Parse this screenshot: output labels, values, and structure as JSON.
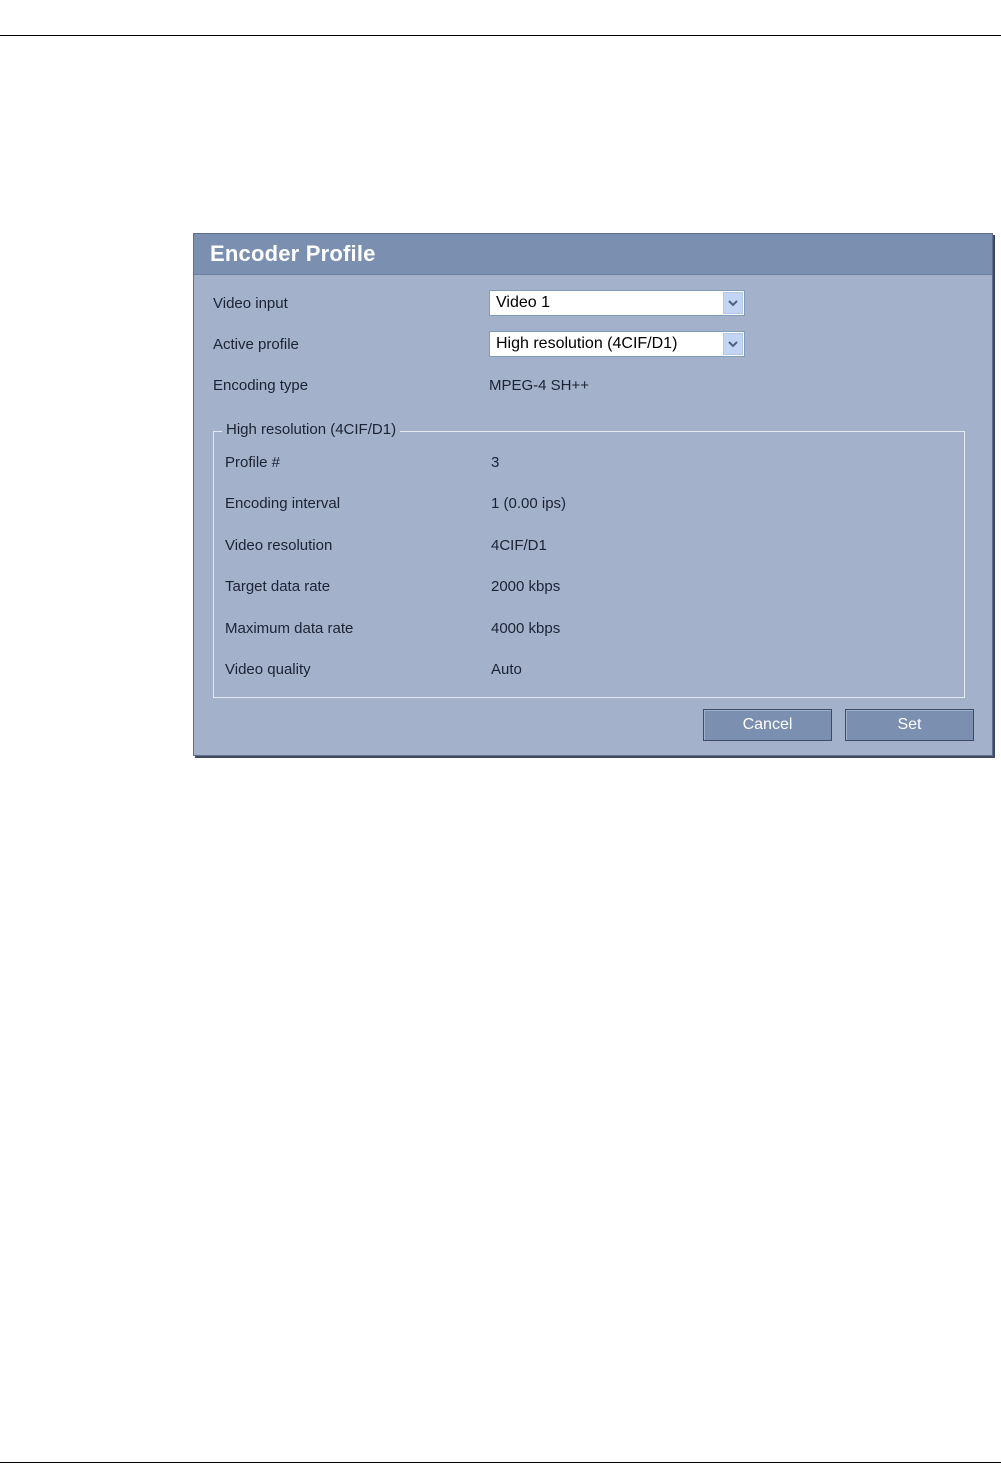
{
  "panel": {
    "title": "Encoder Profile"
  },
  "form": {
    "video_input": {
      "label": "Video input",
      "value": "Video 1"
    },
    "active_profile": {
      "label": "Active profile",
      "value": "High resolution (4CIF/D1)"
    },
    "encoding_type": {
      "label": "Encoding type",
      "value": "MPEG-4 SH++"
    }
  },
  "profile_group": {
    "legend": "High resolution (4CIF/D1)",
    "rows": [
      {
        "label": "Profile #",
        "value": "3"
      },
      {
        "label": "Encoding interval",
        "value": "1 (0.00 ips)"
      },
      {
        "label": "Video resolution",
        "value": "4CIF/D1"
      },
      {
        "label": "Target data rate",
        "value": "2000 kbps"
      },
      {
        "label": "Maximum data rate",
        "value": "4000 kbps"
      },
      {
        "label": "Video quality",
        "value": "Auto"
      }
    ]
  },
  "buttons": {
    "cancel": "Cancel",
    "set": "Set"
  },
  "icons": {
    "dropdown": "chevron-down-icon"
  },
  "colors": {
    "panel_bg": "#a3b1cb",
    "header_bg": "#7b8fb0",
    "button_bg": "#7b8fb0"
  }
}
